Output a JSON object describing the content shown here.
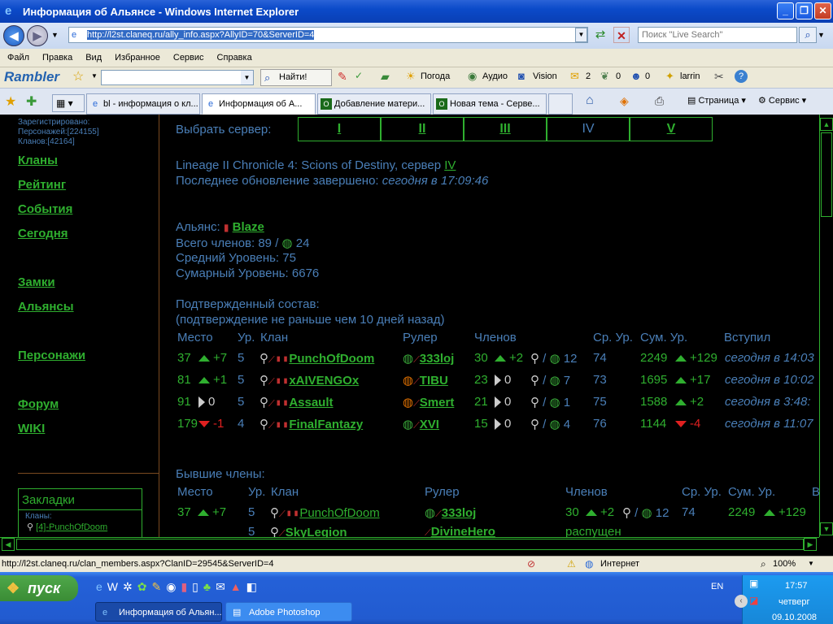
{
  "window": {
    "title": "Информация об Альянсе - Windows Internet Explorer"
  },
  "address": {
    "url": "http://l2st.claneq.ru/ally_info.aspx?AllyID=70&ServerID=4",
    "search_placeholder": "Поиск \"Live Search\""
  },
  "menu": [
    "Файл",
    "Правка",
    "Вид",
    "Избранное",
    "Сервис",
    "Справка"
  ],
  "rambler": {
    "logo": "Rambler",
    "find": "Найти!",
    "weather": "Погода",
    "audio": "Аудио",
    "vision": "Vision",
    "c1": "2",
    "c2": "0",
    "c3": "0",
    "user": "larrin"
  },
  "tabs": [
    "bl - информация о кл...",
    "Информация об А...",
    "Добавление матери...",
    "Новая тема - Серве..."
  ],
  "cmdbar": {
    "page": "Страница",
    "service": "Сервис"
  },
  "left": {
    "stats": [
      "Зарегистрировано:",
      "Персонажей:[224155]",
      "Кланов:[42164]"
    ],
    "nav": [
      "Кланы",
      "Рейтинг",
      "События",
      "Сегодня",
      "Замки",
      "Альянсы",
      "Персонажи",
      "Форум",
      "WIKI"
    ],
    "bookmarks_title": "Закладки",
    "bookmarks_clans": "Кланы:",
    "bookmark_item": "[4]-PunchOfDoom"
  },
  "server_select": {
    "label": "Выбрать сервер:",
    "servers": [
      "I",
      "II",
      "III",
      "IV",
      "V"
    ]
  },
  "info": {
    "game": "Lineage II Chronicle 4: Scions of Destiny, сервер ",
    "server": "IV",
    "updated_label": "Последнее обновление завершено: ",
    "updated_value": "сегодня в 17:09:46",
    "alliance_label": "Альянс: ",
    "alliance_name": "Blaze",
    "members_label": "Всего членов: 89 / ",
    "members_online": "24",
    "avg_level": "Средний Уровень: 75",
    "sum_level": "Сумарный Уровень: 6676"
  },
  "confirmed": {
    "title": "Подтвержденный состав:",
    "subtitle": "(подтверждение не раньше чем 10 дней назад)",
    "headers": [
      "Место",
      "Ур.",
      "Клан",
      "Рулер",
      "Членов",
      "Ср. Ур.",
      "Сум. Ур.",
      "Вступил"
    ],
    "rows": [
      {
        "place": "37",
        "dir": "up",
        "delta": "+7",
        "lvl": "5",
        "clan": "PunchOfDoom",
        "ruler": "333loj",
        "members": "30",
        "mdir": "up",
        "mdelta": "+2",
        "online": "12",
        "avg": "74",
        "sum": "2249",
        "sdir": "up",
        "sdelta": "+129",
        "joined": "сегодня в 14:03"
      },
      {
        "place": "81",
        "dir": "up",
        "delta": "+1",
        "lvl": "5",
        "clan": "xAIVENGOx",
        "ruler": "TIBU",
        "members": "23",
        "mdir": "same",
        "mdelta": "0",
        "online": "7",
        "avg": "73",
        "sum": "1695",
        "sdir": "up",
        "sdelta": "+17",
        "joined": "сегодня в 10:02"
      },
      {
        "place": "91",
        "dir": "same",
        "delta": "0",
        "lvl": "5",
        "clan": "Assault",
        "ruler": "Smert",
        "members": "21",
        "mdir": "same",
        "mdelta": "0",
        "online": "1",
        "avg": "75",
        "sum": "1588",
        "sdir": "up",
        "sdelta": "+2",
        "joined": "сегодня в 3:48:"
      },
      {
        "place": "179",
        "dir": "down",
        "delta": "-1",
        "lvl": "4",
        "clan": "FinalFantazy",
        "ruler": "XVI",
        "members": "15",
        "mdir": "same",
        "mdelta": "0",
        "online": "4",
        "avg": "76",
        "sum": "1144",
        "sdir": "down",
        "sdelta": "-4",
        "joined": "сегодня в 11:07"
      }
    ]
  },
  "former": {
    "title": "Бывшие члены:",
    "headers": [
      "Место",
      "Ур.",
      "Клан",
      "Рулер",
      "Членов",
      "Ср. Ур.",
      "Сум. Ур.",
      "В"
    ],
    "rows": [
      {
        "place": "37",
        "delta": "+7",
        "lvl": "5",
        "clan": "PunchOfDoom",
        "ruler": "333loj",
        "members": "30",
        "mdelta": "+2",
        "online": "12",
        "avg": "74",
        "sum": "2249",
        "sdelta": "+129"
      },
      {
        "lvl": "5",
        "clan": "SkyLegion",
        "ruler": "DivineHero",
        "status": "распущен"
      }
    ]
  },
  "statusbar": {
    "url": "http://l2st.claneq.ru/clan_members.aspx?ClanID=29545&ServerID=4",
    "zone": "Интернет",
    "zoom": "100%"
  },
  "taskbar": {
    "start": "пуск",
    "btn1": "Информация об Альян...",
    "btn2": "Adobe Photoshop",
    "lang": "EN",
    "time": "17:57",
    "day": "четверг",
    "date": "09.10.2008"
  }
}
